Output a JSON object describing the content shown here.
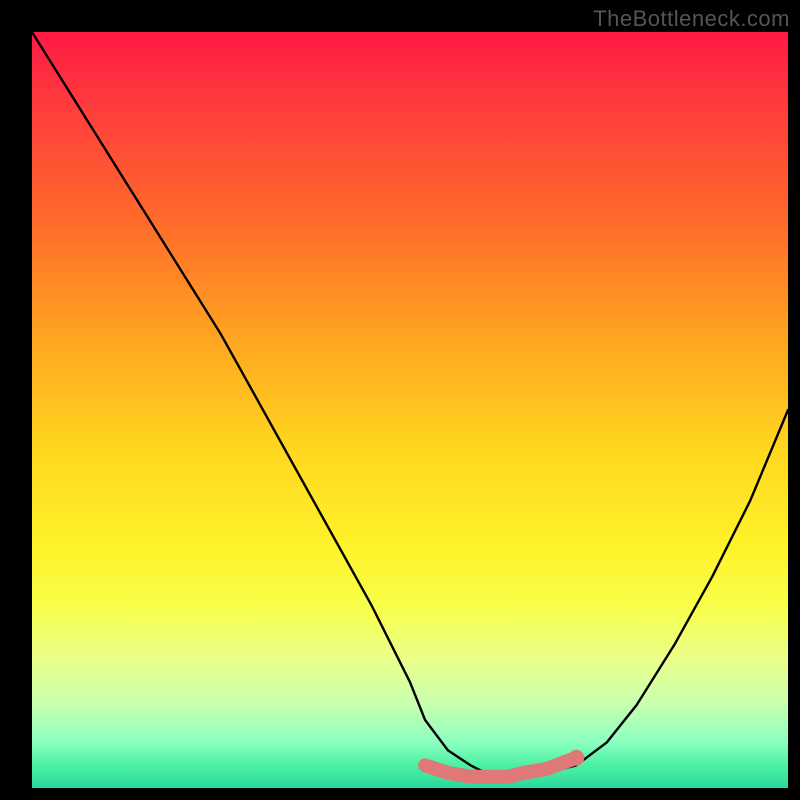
{
  "watermark": "TheBottleneck.com",
  "chart_data": {
    "type": "line",
    "title": "",
    "xlabel": "",
    "ylabel": "",
    "xlim": [
      0,
      100
    ],
    "ylim": [
      0,
      100
    ],
    "series": [
      {
        "name": "bottleneck-curve",
        "x": [
          0,
          5,
          10,
          15,
          20,
          25,
          30,
          35,
          40,
          45,
          50,
          52,
          55,
          58,
          60,
          63,
          65,
          68,
          72,
          76,
          80,
          85,
          90,
          95,
          100
        ],
        "y": [
          100,
          92,
          84,
          76,
          68,
          60,
          51,
          42,
          33,
          24,
          14,
          9,
          5,
          3,
          2,
          1.5,
          1.5,
          2,
          3,
          6,
          11,
          19,
          28,
          38,
          50
        ]
      },
      {
        "name": "bottom-highlight",
        "x": [
          52,
          55,
          58,
          60,
          63,
          65,
          68,
          72
        ],
        "y": [
          3,
          2,
          1.5,
          1.5,
          1.5,
          2,
          2.5,
          4
        ]
      }
    ],
    "background_gradient": {
      "top": "#ff1a44",
      "mid": "#ffe21f",
      "bottom": "#2bd99b"
    },
    "highlight_endpoint": {
      "x": 72,
      "y": 4
    }
  }
}
